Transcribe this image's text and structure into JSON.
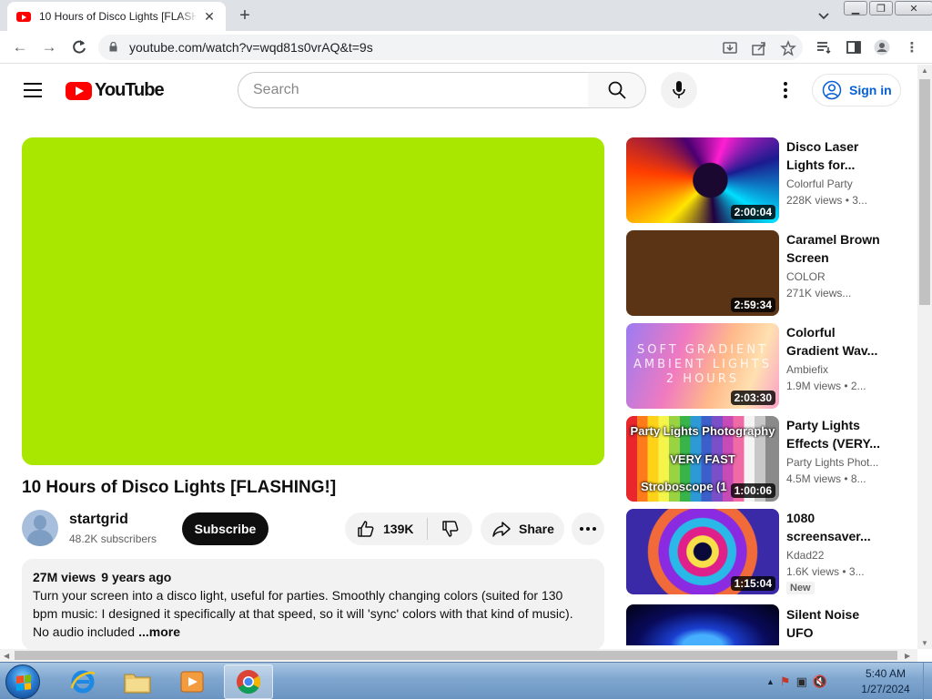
{
  "browser": {
    "tab_title": "10 Hours of Disco Lights [FLASHING!]",
    "url": "youtube.com/watch?v=wqd81s0vrAQ&t=9s"
  },
  "header": {
    "logo_text": "YouTube",
    "search_placeholder": "Search",
    "sign_in": "Sign in"
  },
  "player": {
    "color": "#a9e600"
  },
  "video": {
    "title": "10 Hours of Disco Lights [FLASHING!]",
    "channel": "startgrid",
    "subscribers": "48.2K subscribers",
    "subscribe_label": "Subscribe",
    "likes": "139K",
    "share_label": "Share",
    "views": "27M views",
    "age": "9 years ago",
    "description": "Turn your screen into a disco light, useful for parties. Smoothly changing colors (suited for 130 bpm music: I designed it specifically at that speed, so it will 'sync' colors with that kind of music). No audio included",
    "more_label": "...more"
  },
  "recommendations": [
    {
      "title": "Disco Laser Lights for...",
      "channel": "Colorful Party",
      "meta": "228K views • 3...",
      "duration": "2:00:04"
    },
    {
      "title": "Caramel Brown Screen",
      "channel": "COLOR",
      "meta": "271K views...",
      "duration": "2:59:34"
    },
    {
      "title": "Colorful Gradient Wav...",
      "channel": "Ambiefix",
      "meta": "1.9M views • 2...",
      "duration": "2:03:30",
      "overlay": "SOFT GRADIENT AMBIENT LIGHTS 2 HOURS"
    },
    {
      "title": "Party Lights Effects (VERY...",
      "channel": "Party Lights Phot...",
      "meta": "4.5M views • 8...",
      "duration": "1:00:06",
      "overlay_top": "Party Lights Photography",
      "overlay_mid": "VERY FAST",
      "overlay_bottom": "Stroboscope (1"
    },
    {
      "title": "1080 screensaver...",
      "channel": "Kdad22",
      "meta": "1.6K views • 3...",
      "duration": "1:15:04",
      "badge": "New"
    },
    {
      "title": "Silent Noise UFO"
    }
  ],
  "taskbar": {
    "time": "5:40 AM",
    "date": "1/27/2024"
  }
}
